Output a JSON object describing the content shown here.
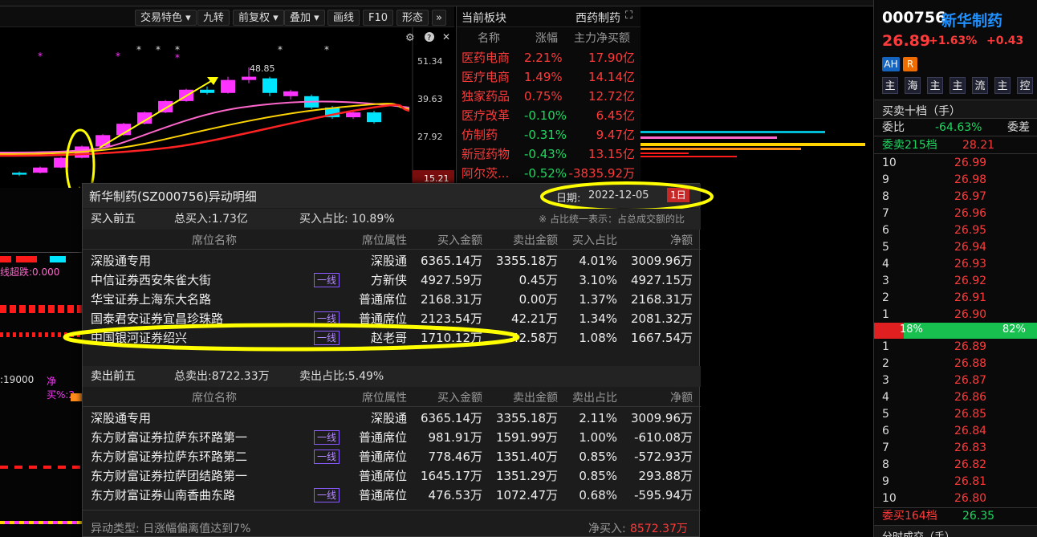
{
  "toolbar": {
    "items": [
      "交易特色",
      "九转",
      "前复权",
      "叠加",
      "画线",
      "F10",
      "形态"
    ],
    "more": "»"
  },
  "chart": {
    "price_labels": [
      "51.34",
      "39.63",
      "27.92",
      "15.21"
    ],
    "peak_label": "48.85",
    "candles": [
      {
        "o": 15.8,
        "c": 16.4,
        "h": 16.8,
        "l": 15.4,
        "up": false
      },
      {
        "o": 16.4,
        "c": 18.0,
        "h": 18.3,
        "l": 16.2,
        "up": true
      },
      {
        "o": 18.0,
        "c": 21.0,
        "h": 21.3,
        "l": 17.8,
        "up": true
      },
      {
        "o": 21.0,
        "c": 24.5,
        "h": 24.8,
        "l": 20.8,
        "up": true
      },
      {
        "o": 24.5,
        "c": 28.0,
        "h": 28.3,
        "l": 24.3,
        "up": true
      },
      {
        "o": 28.0,
        "c": 31.5,
        "h": 31.8,
        "l": 27.8,
        "up": true
      },
      {
        "o": 31.5,
        "c": 35.0,
        "h": 35.3,
        "l": 31.3,
        "up": true
      },
      {
        "o": 35.0,
        "c": 38.5,
        "h": 38.8,
        "l": 34.8,
        "up": true
      },
      {
        "o": 38.5,
        "c": 42.0,
        "h": 42.3,
        "l": 38.3,
        "up": true
      },
      {
        "o": 42.0,
        "c": 41.0,
        "h": 43.0,
        "l": 40.5,
        "up": false
      },
      {
        "o": 41.0,
        "c": 45.0,
        "h": 46.0,
        "l": 40.8,
        "up": true
      },
      {
        "o": 46.0,
        "c": 45.0,
        "h": 48.85,
        "l": 44.0,
        "up": true
      },
      {
        "o": 45.5,
        "c": 41.0,
        "h": 46.0,
        "l": 40.0,
        "up": false
      },
      {
        "o": 41.5,
        "c": 40.0,
        "h": 42.0,
        "l": 39.0,
        "up": true
      },
      {
        "o": 40.0,
        "c": 36.5,
        "h": 40.5,
        "l": 36.0,
        "up": false
      },
      {
        "o": 36.5,
        "c": 33.5,
        "h": 37.0,
        "l": 33.0,
        "up": false
      },
      {
        "o": 33.5,
        "c": 35.0,
        "h": 35.5,
        "l": 33.0,
        "up": true
      },
      {
        "o": 35.0,
        "c": 32.0,
        "h": 35.5,
        "l": 31.5,
        "up": false
      }
    ]
  },
  "sector": {
    "header_title": "当前板块",
    "header_right": "西药制药",
    "cols": [
      "名称",
      "涨幅",
      "主力净买额"
    ],
    "rows": [
      {
        "name": "医药电商",
        "chg": "2.21%",
        "amt": "17.90亿",
        "up": true
      },
      {
        "name": "医疗电商",
        "chg": "1.49%",
        "amt": "14.14亿",
        "up": true
      },
      {
        "name": "独家药品",
        "chg": "0.75%",
        "amt": "12.72亿",
        "up": true
      },
      {
        "name": "医疗改革",
        "chg": "-0.10%",
        "amt": "6.45亿",
        "up": false
      },
      {
        "name": "仿制药",
        "chg": "-0.31%",
        "amt": "9.47亿",
        "up": false
      },
      {
        "name": "新冠药物",
        "chg": "-0.43%",
        "amt": "13.15亿",
        "up": false
      },
      {
        "name": "阿尔茨...",
        "chg": "-0.52%",
        "amt": "-3835.92万",
        "up": false
      }
    ]
  },
  "quote": {
    "code": "000756",
    "name": "新华制药",
    "price": "26.89",
    "chg_pct": "+1.63%",
    "chg": "+0.43",
    "tags": [
      "AH",
      "R"
    ],
    "modes": [
      "主",
      "海",
      "主",
      "主",
      "流",
      "主",
      "控"
    ],
    "book_title": "买卖十档（手）",
    "weibi_label": "委比",
    "weibi": "-64.63%",
    "weicha_label": "委差",
    "ask_total": "委卖215档",
    "ask_total_price": "28.21",
    "asks": [
      {
        "lv": "10",
        "p": "26.99"
      },
      {
        "lv": "9",
        "p": "26.98"
      },
      {
        "lv": "8",
        "p": "26.97"
      },
      {
        "lv": "7",
        "p": "26.96"
      },
      {
        "lv": "6",
        "p": "26.95"
      },
      {
        "lv": "5",
        "p": "26.94"
      },
      {
        "lv": "4",
        "p": "26.93"
      },
      {
        "lv": "3",
        "p": "26.92"
      },
      {
        "lv": "2",
        "p": "26.91"
      },
      {
        "lv": "1",
        "p": "26.90"
      }
    ],
    "ratio_left": "18%",
    "ratio_right": "82%",
    "ratio_left_frac": 0.18,
    "bids": [
      {
        "lv": "1",
        "p": "26.89"
      },
      {
        "lv": "2",
        "p": "26.88"
      },
      {
        "lv": "3",
        "p": "26.87"
      },
      {
        "lv": "4",
        "p": "26.86"
      },
      {
        "lv": "5",
        "p": "26.85"
      },
      {
        "lv": "6",
        "p": "26.84"
      },
      {
        "lv": "7",
        "p": "26.83"
      },
      {
        "lv": "8",
        "p": "26.82"
      },
      {
        "lv": "9",
        "p": "26.81"
      },
      {
        "lv": "10",
        "p": "26.80"
      }
    ],
    "bid_total": "委买164档",
    "bid_total_price": "26.35",
    "bottom": "分时成交（手）"
  },
  "left_labels": {
    "l1": "线超跌:0.000",
    "l2": ":19000",
    "l3": "净买%:2"
  },
  "popup": {
    "title": "新华制药(SZ000756)异动明细",
    "date_label": "日期:",
    "date": "2022-12-05",
    "period": "1日",
    "buy_title": "买入前五",
    "buy_total": "总买入:1.73亿",
    "buy_ratio": "买入占比: 10.89%",
    "note": "※ 占比统一表示：占总成交额的比",
    "buy_cols": [
      "席位名称",
      "席位属性",
      "买入金额",
      "卖出金额",
      "买入占比",
      "净额"
    ],
    "buy_rows": [
      {
        "name": "深股通专用",
        "tag": "",
        "attr": "深股通",
        "buy": "6365.14万",
        "sell": "3355.18万",
        "ratio": "4.01%",
        "net": "3009.96万"
      },
      {
        "name": "中信证券西安朱雀大街",
        "tag": "一线",
        "attr": "方新侠",
        "buy": "4927.59万",
        "sell": "0.45万",
        "ratio": "3.10%",
        "net": "4927.15万"
      },
      {
        "name": "华宝证券上海东大名路",
        "tag": "",
        "attr": "普通席位",
        "buy": "2168.31万",
        "sell": "0.00万",
        "ratio": "1.37%",
        "net": "2168.31万"
      },
      {
        "name": "国泰君安证券宜昌珍珠路",
        "tag": "一线",
        "attr": "普通席位",
        "buy": "2123.54万",
        "sell": "42.21万",
        "ratio": "1.34%",
        "net": "2081.32万"
      },
      {
        "name": "中国银河证券绍兴",
        "tag": "一线",
        "attr": "赵老哥",
        "buy": "1710.12万",
        "sell": "42.58万",
        "ratio": "1.08%",
        "net": "1667.54万"
      }
    ],
    "sell_title": "卖出前五",
    "sell_total": "总卖出:8722.33万",
    "sell_ratio": "卖出占比:5.49%",
    "sell_cols": [
      "席位名称",
      "席位属性",
      "买入金额",
      "卖出金额",
      "卖出占比",
      "净额"
    ],
    "sell_rows": [
      {
        "name": "深股通专用",
        "tag": "",
        "attr": "深股通",
        "buy": "6365.14万",
        "sell": "3355.18万",
        "ratio": "2.11%",
        "net": "3009.96万"
      },
      {
        "name": "东方财富证券拉萨东环路第一",
        "tag": "一线",
        "attr": "普通席位",
        "buy": "981.91万",
        "sell": "1591.99万",
        "ratio": "1.00%",
        "net": "-610.08万"
      },
      {
        "name": "东方财富证券拉萨东环路第二",
        "tag": "一线",
        "attr": "普通席位",
        "buy": "778.46万",
        "sell": "1351.40万",
        "ratio": "0.85%",
        "net": "-572.93万"
      },
      {
        "name": "东方财富证券拉萨团结路第一",
        "tag": "",
        "attr": "普通席位",
        "buy": "1645.17万",
        "sell": "1351.29万",
        "ratio": "0.85%",
        "net": "293.88万"
      },
      {
        "name": "东方财富证券山南香曲东路",
        "tag": "一线",
        "attr": "普通席位",
        "buy": "476.53万",
        "sell": "1072.47万",
        "ratio": "0.68%",
        "net": "-595.94万"
      }
    ],
    "footer_type": "异动类型: 日涨幅偏离值达到7%",
    "footer_net_label": "净买入:",
    "footer_net": "8572.37万"
  },
  "colors": {
    "up": "#ff3a3a",
    "down": "#1ed760",
    "annotation": "#ffff00",
    "magenta": "#ff00ff",
    "cyan": "#00e5ff"
  }
}
